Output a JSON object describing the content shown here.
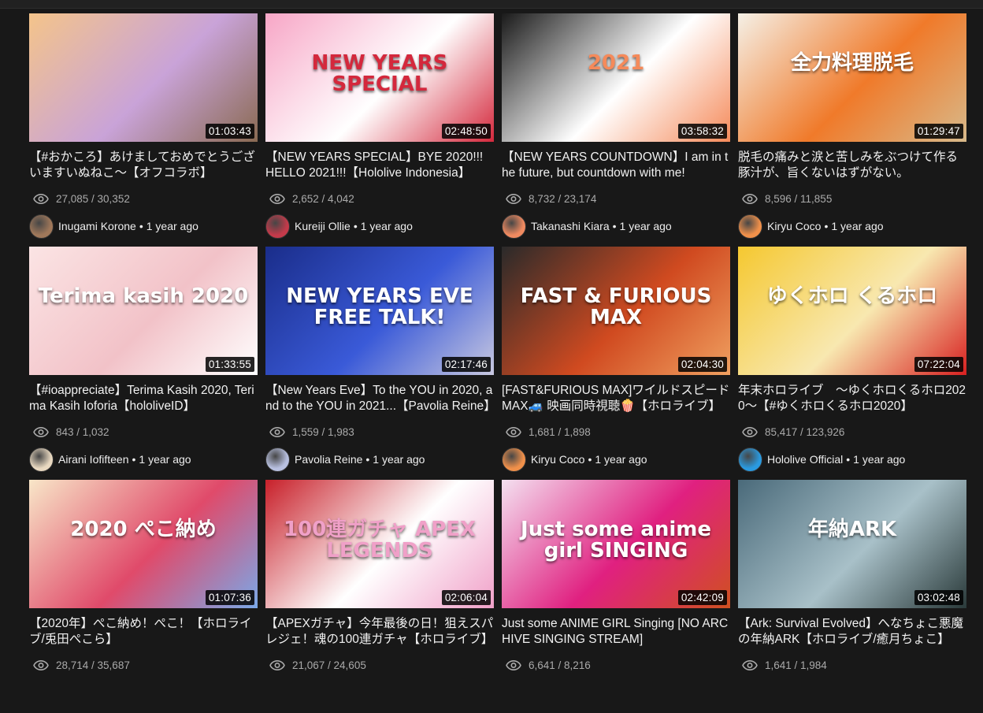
{
  "videos": [
    {
      "duration": "01:03:43",
      "title": "【#おかころ】あけましておめでとうございますいぬねこ～【オフコラボ】",
      "views": "27,085 / 30,352",
      "channel": "Inugami Korone",
      "ago": "1 year ago",
      "colors": [
        "#f4c48a",
        "#c9a3d8",
        "#8a6a52"
      ],
      "avatar_color": "#a0785a"
    },
    {
      "duration": "02:48:50",
      "title": "【NEW YEARS SPECIAL】BYE 2020!!! HELLO 2021!!!【Hololive Indonesia】",
      "views": "2,652 / 4,042",
      "channel": "Kureiji Ollie",
      "ago": "1 year ago",
      "art_text": "NEW YEARS SPECIAL",
      "colors": [
        "#f7a6c6",
        "#ffffff",
        "#d4283c"
      ],
      "avatar_color": "#c43a4a"
    },
    {
      "duration": "03:58:32",
      "title": "【NEW YEARS COUNTDOWN】I am in the future, but countdown with me!",
      "views": "8,732 / 23,174",
      "channel": "Takanashi Kiara",
      "ago": "1 year ago",
      "art_text": "2021",
      "colors": [
        "#1a1a1a",
        "#ffffff",
        "#f58a5a"
      ],
      "avatar_color": "#f08a60"
    },
    {
      "duration": "01:29:47",
      "title": "脱毛の痛みと涙と苦しみをぶつけて作る豚汁が、旨くないはずがない。",
      "views": "8,596 / 11,855",
      "channel": "Kiryu Coco",
      "ago": "1 year ago",
      "art_text": "全力料理脱毛",
      "colors": [
        "#f5f0e6",
        "#f07a2a",
        "#d8b98a"
      ],
      "avatar_color": "#f0904a"
    },
    {
      "duration": "01:33:55",
      "title": "【#ioappreciate】Terima Kasih 2020, Terima Kasih Ioforia【hololiveID】",
      "views": "843 / 1,032",
      "channel": "Airani Iofifteen",
      "ago": "1 year ago",
      "art_text": "Terima kasih 2020",
      "colors": [
        "#fbe4e4",
        "#f2c2c8",
        "#ffffff"
      ],
      "avatar_color": "#e8d8c0"
    },
    {
      "duration": "02:17:46",
      "title": "【New Years Eve】To the YOU in 2020, and to the YOU in 2021...【Pavolia Reine】",
      "views": "1,559 / 1,983",
      "channel": "Pavolia Reine",
      "ago": "1 year ago",
      "art_text": "NEW YEARS EVE FREE TALK!",
      "colors": [
        "#1a2d8a",
        "#3a5ad8",
        "#c8c8e0"
      ],
      "avatar_color": "#b8c0e0"
    },
    {
      "duration": "02:04:30",
      "title": "[FAST&FURIOUS MAX]ワイルドスピードMAX🚙 映画同時視聴🍿【ホロライブ】",
      "views": "1,681 / 1,898",
      "channel": "Kiryu Coco",
      "ago": "1 year ago",
      "art_text": "FAST & FURIOUS MAX",
      "colors": [
        "#2a2a2a",
        "#d04a20",
        "#f0a060"
      ],
      "avatar_color": "#f0904a"
    },
    {
      "duration": "07:22:04",
      "title": "年末ホロライブ　～ゆくホロくるホロ2020～【#ゆくホロくるホロ2020】",
      "views": "85,417 / 123,926",
      "channel": "Hololive Official",
      "ago": "1 year ago",
      "art_text": "ゆくホロ くるホロ",
      "colors": [
        "#f5c830",
        "#f8e8b0",
        "#d82020"
      ],
      "avatar_color": "#2a9ae0"
    },
    {
      "duration": "01:07:36",
      "title": "【2020年】ぺこ納め！ぺこ！【ホロライブ/兎田ぺこら】",
      "views": "28,714 / 35,687",
      "channel": "",
      "ago": "",
      "art_text": "2020 ぺこ納め",
      "colors": [
        "#f8e6c8",
        "#e04a6a",
        "#7aa8e8"
      ],
      "avatar_color": "#7aa8e8"
    },
    {
      "duration": "02:06:04",
      "title": "【APEXガチャ】今年最後の日！狙えスパレジェ！魂の100連ガチャ【ホロライブ】",
      "views": "21,067 / 24,605",
      "channel": "",
      "ago": "",
      "art_text": "100連ガチャ APEX LEGENDS",
      "colors": [
        "#c8202a",
        "#ffffff",
        "#f0a0c8"
      ],
      "avatar_color": "#f0a0c8"
    },
    {
      "duration": "02:42:09",
      "title": "Just some ANIME GIRL Singing [NO ARCHIVE SINGING STREAM]",
      "views": "6,641 / 8,216",
      "channel": "",
      "ago": "",
      "art_text": "Just some anime girl SINGING",
      "colors": [
        "#f4e0f0",
        "#e02080",
        "#d05020"
      ],
      "avatar_color": "#e06030"
    },
    {
      "duration": "03:02:48",
      "title": "【Ark: Survival Evolved】へなちょこ悪魔の年納ARK【ホロライブ/癒月ちょこ】",
      "views": "1,641 / 1,984",
      "channel": "",
      "ago": "",
      "art_text": "年納ARK",
      "colors": [
        "#4a6a7a",
        "#a8c0c8",
        "#2a3a3a"
      ],
      "avatar_color": "#c04060"
    }
  ]
}
